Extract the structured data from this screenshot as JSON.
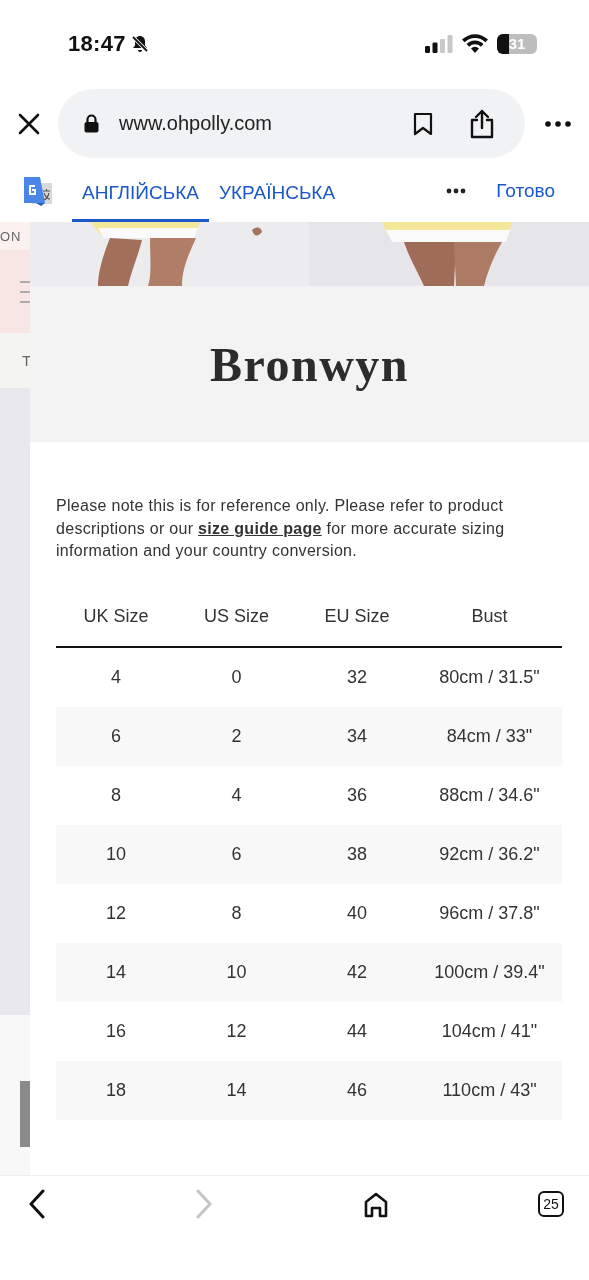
{
  "status_bar": {
    "time": "18:47",
    "battery": "31"
  },
  "browser": {
    "url": "www.ohpolly.com"
  },
  "translate_bar": {
    "languages": [
      {
        "label": "АНГЛІЙСЬКА",
        "selected": true
      },
      {
        "label": "УКРАЇНСЬКА",
        "selected": false
      }
    ],
    "done": "Готово"
  },
  "background_page": {
    "fragments": [
      "ON",
      "T"
    ]
  },
  "size_guide": {
    "title": "Bronwyn",
    "note": {
      "before": "Please note this is for reference only. Please refer to product descriptions or our ",
      "link": "size guide page",
      "after": " for more accurate sizing information and your country conversion."
    },
    "table": {
      "columns": [
        "UK Size",
        "US Size",
        "EU Size",
        "Bust"
      ],
      "rows": [
        [
          "4",
          "0",
          "32",
          "80cm / 31.5\""
        ],
        [
          "6",
          "2",
          "34",
          "84cm / 33\""
        ],
        [
          "8",
          "4",
          "36",
          "88cm / 34.6\""
        ],
        [
          "10",
          "6",
          "38",
          "92cm / 36.2\""
        ],
        [
          "12",
          "8",
          "40",
          "96cm / 37.8\""
        ],
        [
          "14",
          "10",
          "42",
          "100cm / 39.4\""
        ],
        [
          "16",
          "12",
          "44",
          "104cm / 41\""
        ],
        [
          "18",
          "14",
          "46",
          "110cm / 43\""
        ]
      ]
    }
  },
  "toolbar": {
    "back_disabled": false,
    "forward_disabled": true,
    "tab_count": "25"
  }
}
